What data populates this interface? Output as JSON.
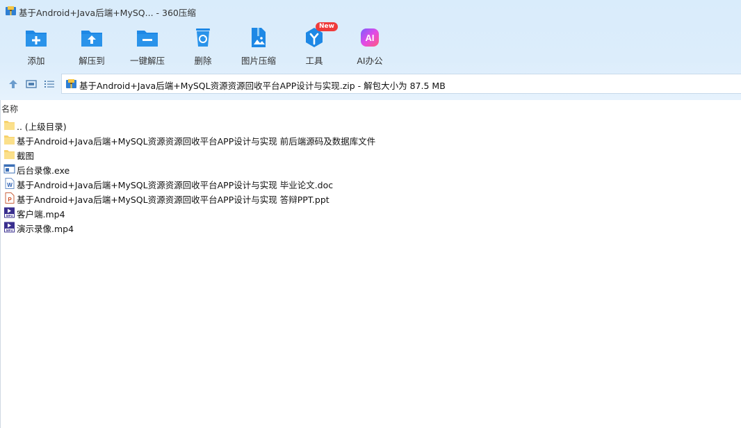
{
  "window": {
    "title": "基于Android+Java后端+MySQ... - 360压缩"
  },
  "toolbar": {
    "items": [
      {
        "label": "添加",
        "icon": "add-folder-icon"
      },
      {
        "label": "解压到",
        "icon": "extract-to-icon"
      },
      {
        "label": "一键解压",
        "icon": "one-click-extract-icon"
      },
      {
        "label": "删除",
        "icon": "delete-recycle-icon"
      },
      {
        "label": "图片压缩",
        "icon": "image-compress-icon"
      },
      {
        "label": "工具",
        "icon": "tools-icon"
      },
      {
        "label": "AI办公",
        "icon": "ai-office-icon"
      }
    ],
    "new_badge": "New"
  },
  "address": {
    "path": "基于Android+Java后端+MySQL资源资源回收平台APP设计与实现.zip - 解包大小为 87.5 MB"
  },
  "list": {
    "column_name": "名称",
    "files": [
      {
        "name": ".. (上级目录)",
        "type": "folder"
      },
      {
        "name": "基于Android+Java后端+MySQL资源资源回收平台APP设计与实现 前后端源码及数据库文件",
        "type": "folder"
      },
      {
        "name": "截图",
        "type": "folder"
      },
      {
        "name": "后台录像.exe",
        "type": "exe"
      },
      {
        "name": "基于Android+Java后端+MySQL资源资源回收平台APP设计与实现 毕业论文.doc",
        "type": "doc"
      },
      {
        "name": "基于Android+Java后端+MySQL资源资源回收平台APP设计与实现 答辩PPT.ppt",
        "type": "ppt"
      },
      {
        "name": "客户端.mp4",
        "type": "mp4"
      },
      {
        "name": "演示录像.mp4",
        "type": "mp4"
      }
    ]
  },
  "colors": {
    "accent_blue": "#1e88e5",
    "folder_yellow": "#f7d26b",
    "new_badge_red": "#ef3b3b"
  }
}
